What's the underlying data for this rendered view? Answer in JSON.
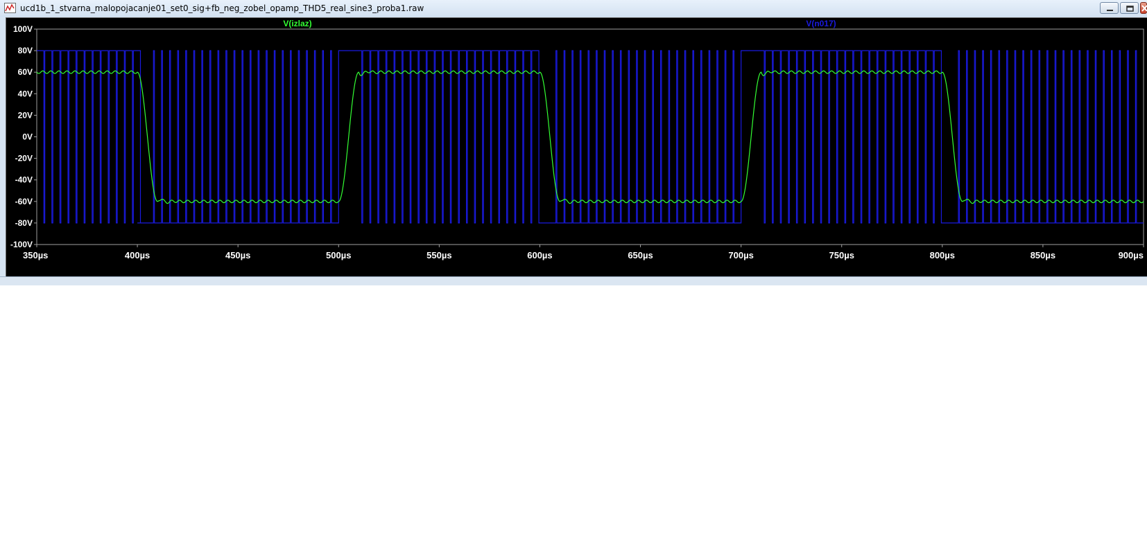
{
  "window": {
    "title": "ucd1b_1_stvarna_malopojacanje01_set0_sig+fb_neg_zobel_opamp_THD5_real_sine3_proba1.raw",
    "icon": "waveform-icon",
    "controls": [
      "minimize-icon",
      "restore-icon",
      "close-icon"
    ]
  },
  "chart_data": {
    "type": "line",
    "background": "#000000",
    "x_unit": "µs",
    "y_unit": "V",
    "xlim": [
      350,
      900
    ],
    "ylim": [
      -100,
      100
    ],
    "x_ticks": [
      350,
      400,
      450,
      500,
      550,
      600,
      650,
      700,
      750,
      800,
      850,
      900
    ],
    "x_tick_labels": [
      "350µs",
      "400µs",
      "450µs",
      "500µs",
      "550µs",
      "600µs",
      "650µs",
      "700µs",
      "750µs",
      "800µs",
      "850µs",
      "900µs"
    ],
    "y_ticks": [
      100,
      80,
      60,
      40,
      20,
      0,
      -20,
      -40,
      -60,
      -80,
      -100
    ],
    "y_tick_labels": [
      "100V",
      "80V",
      "60V",
      "40V",
      "20V",
      "0V",
      "-20V",
      "-40V",
      "-60V",
      "-80V",
      "-100V"
    ],
    "grid": false,
    "series": [
      {
        "name": "V(izlaz)",
        "color": "#33ff33",
        "shape": "square-wave",
        "levels": [
          60,
          -60
        ],
        "ripple_amplitude": 1.2,
        "transitions": [
          {
            "t_start": 400,
            "t_end": 410,
            "from": 60,
            "to": -60
          },
          {
            "t_start": 500,
            "t_end": 510,
            "from": -60,
            "to": 60
          },
          {
            "t_start": 600,
            "t_end": 610,
            "from": 60,
            "to": -60
          },
          {
            "t_start": 700,
            "t_end": 710,
            "from": -60,
            "to": 60
          },
          {
            "t_start": 800,
            "t_end": 810,
            "from": 60,
            "to": -60
          }
        ],
        "initial_level": 60
      },
      {
        "name": "V(n017)",
        "color": "#1a1ae0",
        "shape": "pwm",
        "levels": [
          80,
          -80
        ],
        "pwm_period": 4,
        "duty_when_output_high": 0.88,
        "duty_when_output_low": 0.12,
        "saturated_segments": [
          {
            "t_start": 400,
            "t_end": 408,
            "level": -80
          },
          {
            "t_start": 500,
            "t_end": 508,
            "level": 80
          },
          {
            "t_start": 600,
            "t_end": 608,
            "level": -80
          },
          {
            "t_start": 700,
            "t_end": 708,
            "level": 80
          },
          {
            "t_start": 800,
            "t_end": 808,
            "level": -80
          }
        ]
      }
    ]
  }
}
